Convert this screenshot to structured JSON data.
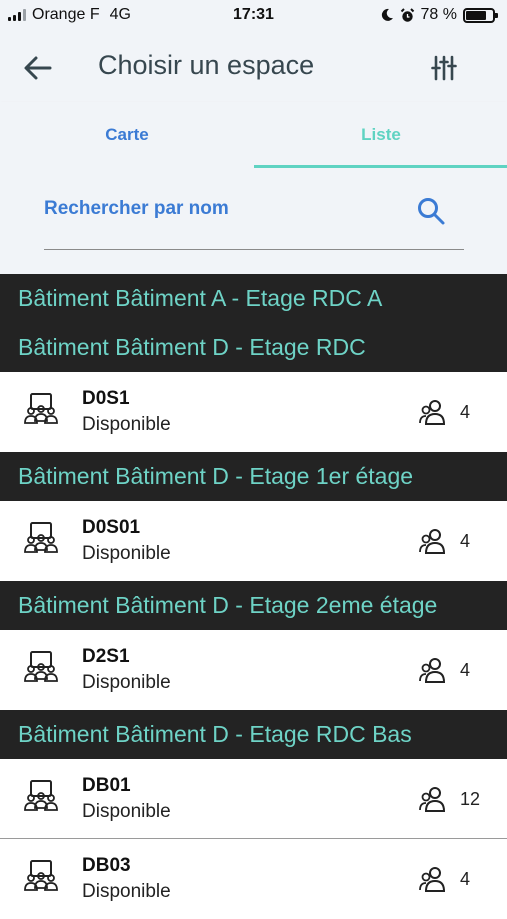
{
  "status_bar": {
    "carrier": "Orange F",
    "network": "4G",
    "time": "17:31",
    "battery": "78 %",
    "battery_level": 0.78
  },
  "header": {
    "title": "Choisir un espace",
    "back_icon": "arrow-left-icon",
    "filter_icon": "sliders-icon"
  },
  "tabs": [
    {
      "label": "Carte",
      "active": false
    },
    {
      "label": "Liste",
      "active": true
    }
  ],
  "search": {
    "placeholder": "Rechercher par nom",
    "icon": "search-icon"
  },
  "groups": [
    {
      "header": "Bâtiment Bâtiment A - Etage RDC A",
      "items": []
    },
    {
      "header": "Bâtiment Bâtiment D - Etage RDC",
      "items": [
        {
          "name": "D0S1",
          "status": "Disponible",
          "capacity": "4"
        }
      ]
    },
    {
      "header": "Bâtiment Bâtiment D - Etage 1er étage",
      "items": [
        {
          "name": "D0S01",
          "status": "Disponible",
          "capacity": "4"
        }
      ]
    },
    {
      "header": "Bâtiment Bâtiment D - Etage 2eme étage",
      "items": [
        {
          "name": "D2S1",
          "status": "Disponible",
          "capacity": "4"
        }
      ]
    },
    {
      "header": "Bâtiment Bâtiment D - Etage RDC Bas",
      "items": [
        {
          "name": "DB01",
          "status": "Disponible",
          "capacity": "12"
        },
        {
          "name": "DB03",
          "status": "Disponible",
          "capacity": "4"
        }
      ]
    }
  ],
  "colors": {
    "accent_blue": "#3b7bd4",
    "accent_teal": "#5fd3c2",
    "header_bg": "#232323",
    "header_text": "#6ed3c6"
  }
}
